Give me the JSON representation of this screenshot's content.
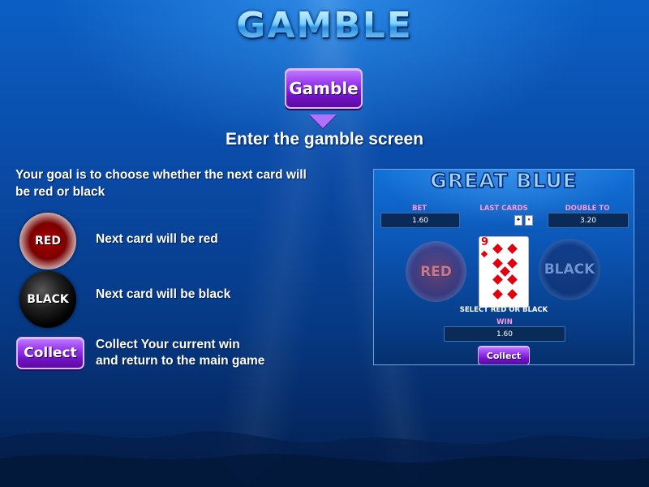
{
  "title": "GAMBLE",
  "gamble_button_label": "Gamble",
  "subtitle": "Enter the gamble screen",
  "goal_text": "Your goal is to choose whether the next card will be red or black",
  "options": [
    {
      "orb_label": "RED",
      "description": "Next card will be red"
    },
    {
      "orb_label": "BLACK",
      "description": "Next card will be black"
    }
  ],
  "collect": {
    "button_label": "Collect",
    "description_line1": "Collect Your current win",
    "description_line2": "and return to the main game"
  },
  "panel": {
    "game_title": "GREAT BLUE",
    "bet_label": "BET",
    "bet_value": "1.60",
    "last_cards_label": "LAST CARDS",
    "double_to_label": "DOUBLE TO",
    "double_to_value": "3.20",
    "red_label": "RED",
    "black_label": "BLACK",
    "card_rank": "9",
    "select_text": "SELECT RED OR BLACK",
    "win_label": "WIN",
    "win_value": "1.60",
    "collect_label": "Collect"
  },
  "colors": {
    "accent_purple": "#9b3df0",
    "panel_label_pink": "#ff9ad8",
    "card_red": "#e00010"
  }
}
